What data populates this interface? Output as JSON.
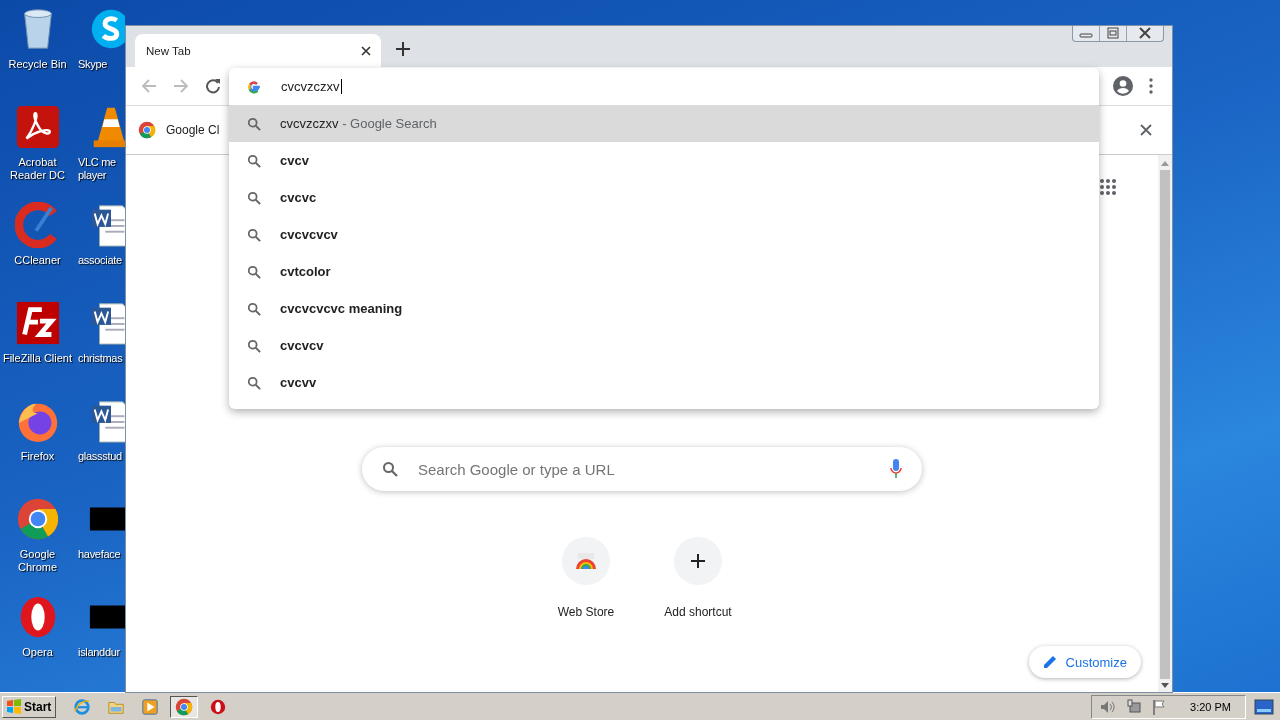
{
  "desktop": {
    "icons": [
      {
        "label": "Recycle Bin",
        "kind": "recycle-bin"
      },
      {
        "label": "Skype",
        "kind": "skype"
      },
      {
        "label": "Acrobat Reader DC",
        "kind": "acrobat"
      },
      {
        "label": "VLC me player",
        "kind": "vlc"
      },
      {
        "label": "CCleaner",
        "kind": "ccleaner"
      },
      {
        "label": "associate",
        "kind": "document"
      },
      {
        "label": "FileZilla Client",
        "kind": "filezilla"
      },
      {
        "label": "christmas",
        "kind": "document"
      },
      {
        "label": "Firefox",
        "kind": "firefox"
      },
      {
        "label": "glassstud",
        "kind": "document"
      },
      {
        "label": "Google Chrome",
        "kind": "chrome"
      },
      {
        "label": "haveface",
        "kind": "redacted"
      },
      {
        "label": "Opera",
        "kind": "opera"
      },
      {
        "label": "islanddur",
        "kind": "redacted"
      }
    ]
  },
  "browser": {
    "tabs": [
      {
        "title": "New Tab",
        "selected": true
      }
    ],
    "omnibox": {
      "value": "cvcvzczxv"
    },
    "suggestions": [
      {
        "text": "cvcvzczxv",
        "suffix": "- Google Search",
        "kind": "verbatim",
        "selected": true
      },
      {
        "text": "cvcv",
        "kind": "suggestion",
        "selected": false
      },
      {
        "text": "cvcvc",
        "kind": "suggestion",
        "selected": false
      },
      {
        "text": "cvcvcvcv",
        "kind": "suggestion",
        "selected": false
      },
      {
        "text": "cvtcolor",
        "kind": "suggestion",
        "selected": false
      },
      {
        "text": "cvcvcvcvc meaning",
        "kind": "suggestion",
        "selected": false
      },
      {
        "text": "cvcvcv",
        "kind": "suggestion",
        "selected": false
      },
      {
        "text": "cvcvv",
        "kind": "suggestion",
        "selected": false
      }
    ],
    "infobar": {
      "text": "Google Cl"
    },
    "new_tab_page": {
      "search": {
        "placeholder": "Search Google or type a URL"
      },
      "shortcuts": [
        {
          "label": "Web Store",
          "kind": "web-store"
        },
        {
          "label": "Add shortcut",
          "kind": "add"
        }
      ],
      "customize": "Customize"
    }
  },
  "taskbar": {
    "start": "Start",
    "apps": [
      {
        "kind": "ie",
        "selected": false
      },
      {
        "kind": "folder",
        "selected": false
      },
      {
        "kind": "media",
        "selected": false
      },
      {
        "kind": "chrome",
        "selected": true
      },
      {
        "kind": "opera",
        "selected": false
      }
    ],
    "clock": "3:20 PM"
  }
}
